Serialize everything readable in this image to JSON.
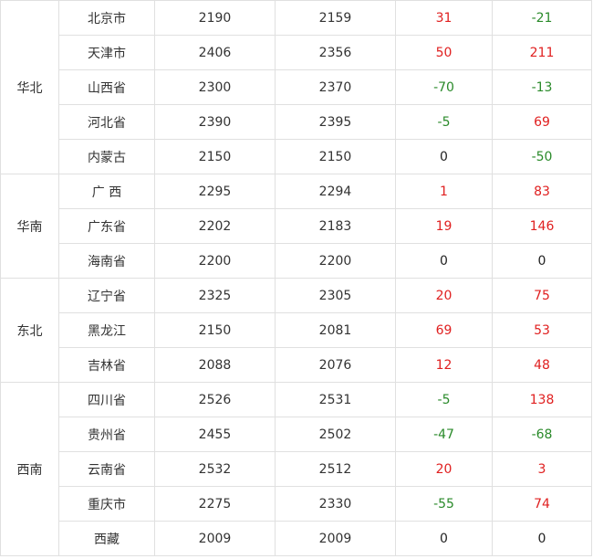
{
  "colors": {
    "positive": "#e02020",
    "negative": "#2a8a2a",
    "zero": "#222222"
  },
  "table": {
    "groups": [
      {
        "region": "华北",
        "rows": [
          {
            "province": "北京市",
            "price_a": "2190",
            "price_b": "2159",
            "change_1": "31",
            "change_2": "-21"
          },
          {
            "province": "天津市",
            "price_a": "2406",
            "price_b": "2356",
            "change_1": "50",
            "change_2": "211"
          },
          {
            "province": "山西省",
            "price_a": "2300",
            "price_b": "2370",
            "change_1": "-70",
            "change_2": "-13"
          },
          {
            "province": "河北省",
            "price_a": "2390",
            "price_b": "2395",
            "change_1": "-5",
            "change_2": "69"
          },
          {
            "province": "内蒙古",
            "price_a": "2150",
            "price_b": "2150",
            "change_1": "0",
            "change_2": "-50"
          }
        ]
      },
      {
        "region": "华南",
        "rows": [
          {
            "province": "广  西",
            "price_a": "2295",
            "price_b": "2294",
            "change_1": "1",
            "change_2": "83"
          },
          {
            "province": "广东省",
            "price_a": "2202",
            "price_b": "2183",
            "change_1": "19",
            "change_2": "146"
          },
          {
            "province": "海南省",
            "price_a": "2200",
            "price_b": "2200",
            "change_1": "0",
            "change_2": "0"
          }
        ]
      },
      {
        "region": "东北",
        "rows": [
          {
            "province": "辽宁省",
            "price_a": "2325",
            "price_b": "2305",
            "change_1": "20",
            "change_2": "75"
          },
          {
            "province": "黑龙江",
            "price_a": "2150",
            "price_b": "2081",
            "change_1": "69",
            "change_2": "53"
          },
          {
            "province": "吉林省",
            "price_a": "2088",
            "price_b": "2076",
            "change_1": "12",
            "change_2": "48"
          }
        ]
      },
      {
        "region": "西南",
        "rows": [
          {
            "province": "四川省",
            "price_a": "2526",
            "price_b": "2531",
            "change_1": "-5",
            "change_2": "138"
          },
          {
            "province": "贵州省",
            "price_a": "2455",
            "price_b": "2502",
            "change_1": "-47",
            "change_2": "-68"
          },
          {
            "province": "云南省",
            "price_a": "2532",
            "price_b": "2512",
            "change_1": "20",
            "change_2": "3"
          },
          {
            "province": "重庆市",
            "price_a": "2275",
            "price_b": "2330",
            "change_1": "-55",
            "change_2": "74"
          },
          {
            "province": "西藏",
            "price_a": "2009",
            "price_b": "2009",
            "change_1": "0",
            "change_2": "0"
          }
        ]
      }
    ]
  }
}
